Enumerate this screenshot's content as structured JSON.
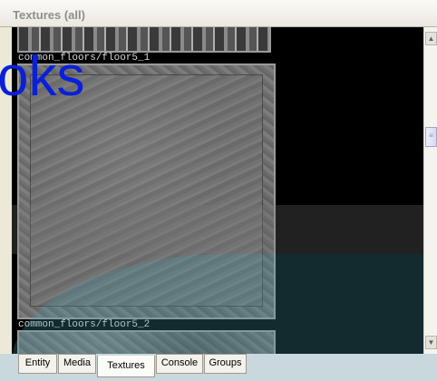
{
  "window": {
    "title": "Textures (all)"
  },
  "textures": [
    {
      "label": "common_floors/floor5_1"
    },
    {
      "label": "common_floors/floor5_2"
    }
  ],
  "overlay": {
    "text": "oks"
  },
  "scrollbar": {
    "up_arrow": "▲",
    "down_arrow": "▼",
    "thumb_grip": "≡"
  },
  "tabs": [
    {
      "label": "Entity"
    },
    {
      "label": "Media"
    },
    {
      "label": "Textures",
      "active": true
    },
    {
      "label": "Console"
    },
    {
      "label": "Groups"
    }
  ],
  "colors": {
    "overlay_text": "#0a1fd8",
    "viewport_bg": "#000000",
    "tab_bar": "#c9d8dd"
  }
}
